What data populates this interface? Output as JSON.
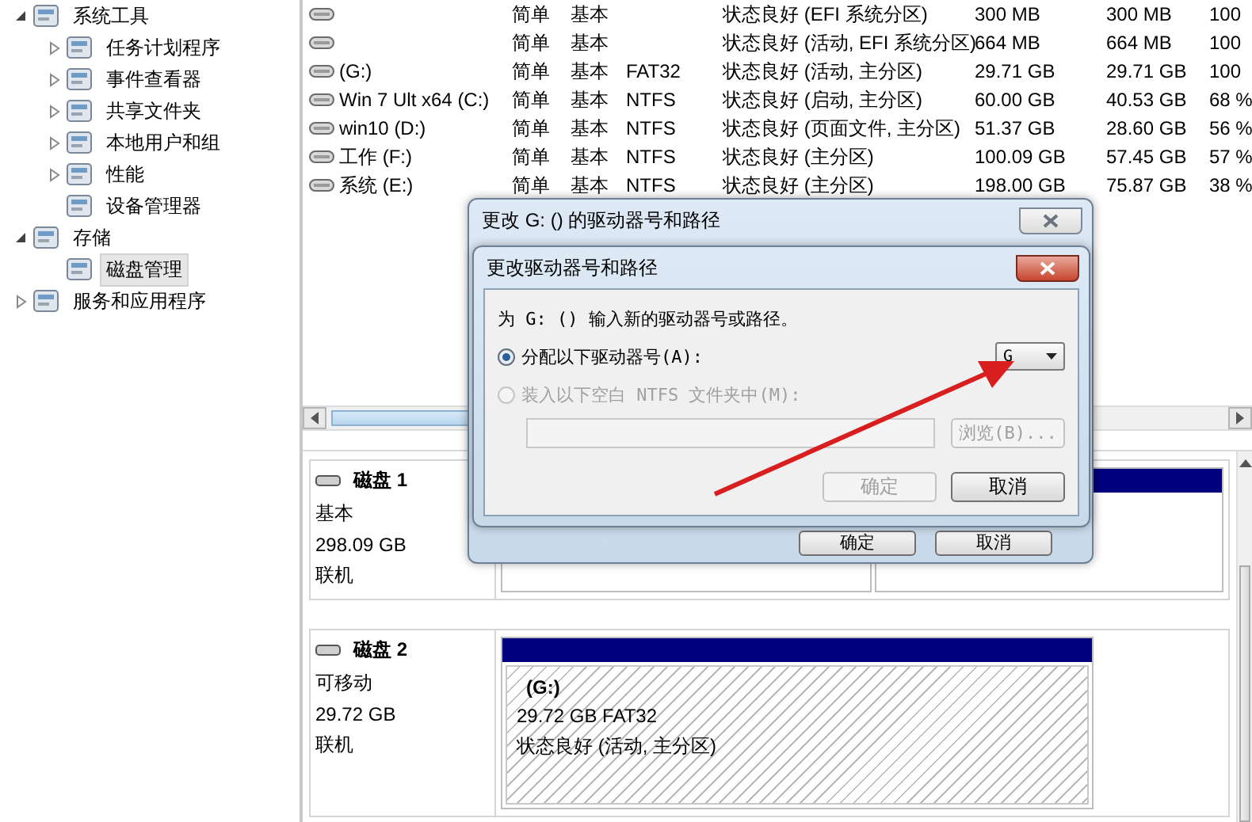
{
  "tree": [
    {
      "label": "系统工具",
      "expanded": true,
      "selected": false,
      "children": [
        {
          "label": "任务计划程序",
          "expanded": false,
          "selected": false
        },
        {
          "label": "事件查看器",
          "expanded": false,
          "selected": false
        },
        {
          "label": "共享文件夹",
          "expanded": false,
          "selected": false
        },
        {
          "label": "本地用户和组",
          "expanded": false,
          "selected": false
        },
        {
          "label": "性能",
          "expanded": false,
          "selected": false
        },
        {
          "label": "设备管理器",
          "selected": false
        }
      ]
    },
    {
      "label": "存储",
      "expanded": true,
      "selected": false,
      "children": [
        {
          "label": "磁盘管理",
          "selected": true
        }
      ]
    },
    {
      "label": "服务和应用程序",
      "expanded": false,
      "selected": false
    }
  ],
  "volumes": [
    {
      "layout": "简单",
      "type": "基本",
      "status": "状态良好 (EFI 系统分区)",
      "capacity": "300 MB",
      "free": "300 MB",
      "percent_free": "100"
    },
    {
      "layout": "简单",
      "type": "基本",
      "status": "状态良好 (活动, EFI 系统分区)",
      "capacity": "664 MB",
      "free": "664 MB",
      "percent_free": "100"
    },
    {
      "name": "(G:)",
      "layout": "简单",
      "type": "基本",
      "filesystem": "FAT32",
      "status": "状态良好 (活动, 主分区)",
      "capacity": "29.71 GB",
      "free": "29.71 GB",
      "percent_free": "100"
    },
    {
      "name": "Win 7 Ult x64 (C:)",
      "layout": "简单",
      "type": "基本",
      "filesystem": "NTFS",
      "status": "状态良好 (启动, 主分区)",
      "capacity": "60.00 GB",
      "free": "40.53 GB",
      "percent_free": "68 %"
    },
    {
      "name": "win10 (D:)",
      "layout": "简单",
      "type": "基本",
      "filesystem": "NTFS",
      "status": "状态良好 (页面文件, 主分区)",
      "capacity": "51.37 GB",
      "free": "28.60 GB",
      "percent_free": "56 %"
    },
    {
      "name": "工作 (F:)",
      "layout": "简单",
      "type": "基本",
      "filesystem": "NTFS",
      "status": "状态良好 (主分区)",
      "capacity": "100.09 GB",
      "free": "57.45 GB",
      "percent_free": "57 %"
    },
    {
      "name": "系统 (E:)",
      "layout": "简单",
      "type": "基本",
      "filesystem": "NTFS",
      "status": "状态良好 (主分区)",
      "capacity": "198.00 GB",
      "free": "75.87 GB",
      "percent_free": "38 %"
    }
  ],
  "disks": [
    {
      "name": "磁盘 1",
      "type": "基本",
      "size": "298.09 GB",
      "status": "联机"
    },
    {
      "name": "磁盘 2",
      "type": "可移动",
      "size": "29.72 GB",
      "status": "联机",
      "partitions": [
        {
          "label": "(G:)",
          "size": "29.72 GB FAT32",
          "status": "状态良好 (活动, 主分区)"
        }
      ]
    }
  ],
  "back_dialog": {
    "title": "更改 G: () 的驱动器号和路径",
    "buttons": [
      {
        "label": "确定",
        "disabled": false
      },
      {
        "label": "取消",
        "disabled": false
      }
    ]
  },
  "dialog": {
    "title": "更改驱动器号和路径",
    "prompt": "为 G: () 输入新的驱动器号或路径。",
    "options": [
      {
        "label": "分配以下驱动器号(A):",
        "selected": true,
        "disabled": false
      },
      {
        "label": "装入以下空白 NTFS 文件夹中(M):",
        "selected": false,
        "disabled": true
      }
    ],
    "drive_letter": "G",
    "path_field": {
      "disabled": true
    },
    "browse_button": {
      "label": "浏览(B)...",
      "disabled": true
    },
    "buttons": [
      {
        "label": "确定",
        "disabled": true
      },
      {
        "label": "取消",
        "disabled": false
      }
    ]
  }
}
